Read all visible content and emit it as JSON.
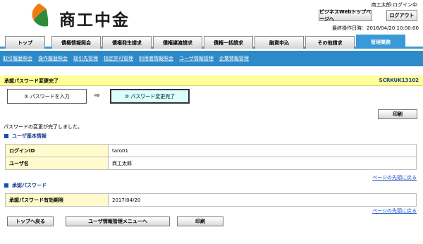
{
  "header": {
    "logo_text": "商工中金",
    "user_status": "商工太郎:ログイン中",
    "web_button": "ビジネスWebトップページへ",
    "logout_button": "ログアウト",
    "last_login": "最終操作日時：2016/04/20 10:00:00"
  },
  "tabs": [
    {
      "label": "トップ"
    },
    {
      "label": "債権情報照会"
    },
    {
      "label": "債権発生請求"
    },
    {
      "label": "債権譲渡請求"
    },
    {
      "label": "債権一括請求"
    },
    {
      "label": "融資申込"
    },
    {
      "label": "その他請求"
    },
    {
      "label": "管理業務"
    }
  ],
  "subnav": [
    {
      "label": "取引履歴照会"
    },
    {
      "label": "操作履歴照会"
    },
    {
      "label": "取引先管理"
    },
    {
      "label": "指定許可管理"
    },
    {
      "label": "利用者情報照会"
    },
    {
      "label": "ユーザ情報管理"
    },
    {
      "label": "企業情報管理"
    }
  ],
  "page": {
    "title": "承認パスワード変更完了",
    "screen_id": "SCRKUK13102",
    "step1": "① パスワードを入力",
    "arrow": "⇨",
    "step2": "② パスワード変更完了",
    "print_label": "印刷",
    "message": "パスワードの変更が完了しました。"
  },
  "user_info": {
    "section_title": "ユーザ基本情報",
    "rows": [
      {
        "key": "ログインID",
        "value": "taro01"
      },
      {
        "key": "ユーザ名",
        "value": "商工太郎"
      }
    ]
  },
  "password": {
    "section_title": "承認パスワード",
    "rows": [
      {
        "key": "承認パスワード有効期限",
        "value": "2017/04/20"
      }
    ]
  },
  "top_link": "ページの先頭に戻る",
  "footer": {
    "back_top": "トップへ戻る",
    "back_menu": "ユーザ情報管理メニューへ",
    "print": "印刷"
  },
  "colors": {
    "accent": "#3a9ad9",
    "subnav": "#2d8ac8",
    "title_bar": "#ffff99",
    "label_cell": "#fffbcc",
    "current_step": "#d9ffff",
    "logo_orange": "#f07b14",
    "logo_green": "#2e8b3a"
  }
}
